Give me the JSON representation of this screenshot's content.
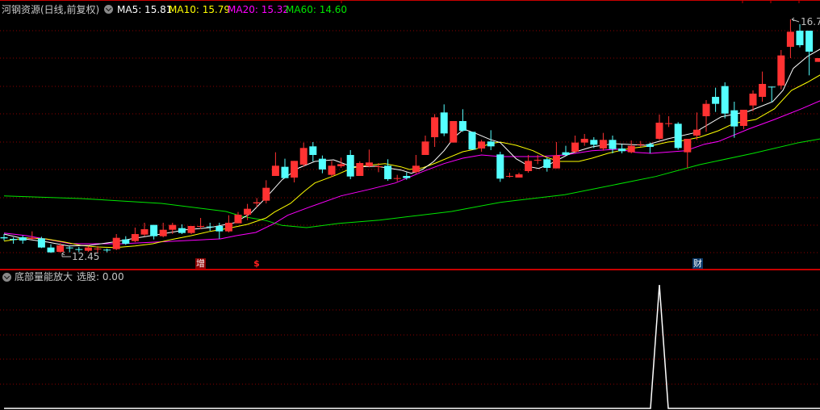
{
  "header": {
    "title": "河钢资源(日线,前复权)",
    "ma5": "MA5: 15.81",
    "ma10": "MA10: 15.79",
    "ma20": "MA20: 15.32",
    "ma60": "MA60: 14.60"
  },
  "lower_header": {
    "indicator_name": "底部量能放大",
    "value_text": "选股: 0.00"
  },
  "labels": {
    "high": "16.7",
    "low": "12.45"
  },
  "markers": {
    "zeng": "增",
    "dollar": "$",
    "cai": "财"
  },
  "colors": {
    "up": "#ff3232",
    "down": "#54ffff",
    "ma5": "#ffffff",
    "ma10": "#ffff00",
    "ma20": "#ff00ff",
    "ma60": "#00e600",
    "grid": "#8b0000",
    "separator": "#c80000"
  },
  "chart_data": {
    "type": "candlestick",
    "price_range": [
      12.45,
      16.78
    ],
    "candles": [
      [
        12.74,
        12.8,
        12.68,
        12.72
      ],
      [
        12.71,
        12.74,
        12.62,
        12.69
      ],
      [
        12.74,
        12.77,
        12.62,
        12.68
      ],
      [
        12.71,
        12.85,
        12.7,
        12.73
      ],
      [
        12.72,
        12.75,
        12.54,
        12.55
      ],
      [
        12.55,
        12.61,
        12.45,
        12.46
      ],
      [
        12.47,
        12.63,
        12.45,
        12.59
      ],
      [
        12.55,
        12.57,
        12.46,
        12.54
      ],
      [
        12.52,
        12.56,
        12.46,
        12.51
      ],
      [
        12.49,
        12.58,
        12.47,
        12.55
      ],
      [
        12.52,
        12.58,
        12.46,
        12.53
      ],
      [
        12.51,
        12.53,
        12.46,
        12.5
      ],
      [
        12.52,
        12.8,
        12.5,
        12.73
      ],
      [
        12.7,
        12.76,
        12.6,
        12.62
      ],
      [
        12.67,
        12.92,
        12.65,
        12.8
      ],
      [
        12.79,
        13.01,
        12.76,
        12.89
      ],
      [
        12.97,
        12.97,
        12.7,
        12.76
      ],
      [
        12.76,
        13.01,
        12.74,
        12.88
      ],
      [
        12.88,
        13.01,
        12.8,
        12.97
      ],
      [
        12.91,
        12.98,
        12.8,
        12.82
      ],
      [
        12.82,
        12.95,
        12.8,
        12.95
      ],
      [
        12.94,
        13.1,
        12.89,
        12.95
      ],
      [
        12.94,
        13.01,
        12.86,
        12.93
      ],
      [
        12.95,
        13.01,
        12.71,
        12.85
      ],
      [
        12.85,
        13.15,
        12.83,
        13.01
      ],
      [
        13.0,
        13.21,
        13.0,
        13.16
      ],
      [
        13.16,
        13.36,
        13.06,
        13.27
      ],
      [
        13.37,
        13.47,
        13.3,
        13.39
      ],
      [
        13.42,
        13.8,
        13.37,
        13.66
      ],
      [
        13.88,
        14.32,
        13.88,
        14.07
      ],
      [
        14.05,
        14.2,
        13.84,
        13.84
      ],
      [
        13.85,
        14.16,
        13.76,
        14.16
      ],
      [
        14.09,
        14.5,
        14.05,
        14.4
      ],
      [
        14.43,
        14.51,
        14.15,
        14.27
      ],
      [
        14.2,
        14.26,
        13.93,
        14.0
      ],
      [
        13.9,
        14.16,
        13.86,
        14.07
      ],
      [
        14.06,
        14.22,
        14.03,
        14.1
      ],
      [
        14.27,
        14.36,
        13.82,
        13.87
      ],
      [
        13.88,
        14.15,
        13.88,
        14.12
      ],
      [
        14.06,
        14.37,
        14.04,
        14.13
      ],
      [
        14.05,
        14.12,
        13.95,
        14.06
      ],
      [
        14.07,
        14.19,
        13.79,
        13.82
      ],
      [
        13.83,
        13.9,
        13.78,
        13.84
      ],
      [
        13.88,
        13.95,
        13.81,
        13.84
      ],
      [
        13.95,
        14.27,
        13.92,
        14.07
      ],
      [
        14.27,
        14.63,
        14.27,
        14.52
      ],
      [
        14.6,
        15.03,
        14.42,
        14.97
      ],
      [
        15.06,
        15.21,
        14.62,
        14.67
      ],
      [
        14.5,
        14.9,
        14.5,
        14.9
      ],
      [
        14.9,
        15.12,
        14.7,
        14.72
      ],
      [
        14.7,
        14.7,
        14.37,
        14.37
      ],
      [
        14.39,
        14.55,
        14.33,
        14.52
      ],
      [
        14.52,
        14.73,
        14.36,
        14.43
      ],
      [
        14.28,
        14.33,
        13.77,
        13.83
      ],
      [
        13.87,
        13.94,
        13.85,
        13.88
      ],
      [
        13.85,
        13.94,
        13.85,
        13.91
      ],
      [
        13.97,
        14.27,
        13.94,
        14.16
      ],
      [
        14.17,
        14.27,
        14.1,
        14.18
      ],
      [
        14.19,
        14.22,
        13.96,
        14.03
      ],
      [
        14.02,
        14.51,
        14.02,
        14.26
      ],
      [
        14.32,
        14.44,
        14.26,
        14.27
      ],
      [
        14.33,
        14.63,
        14.3,
        14.5
      ],
      [
        14.5,
        14.66,
        14.44,
        14.57
      ],
      [
        14.55,
        14.6,
        14.4,
        14.46
      ],
      [
        14.39,
        14.68,
        14.35,
        14.55
      ],
      [
        14.55,
        14.63,
        14.3,
        14.38
      ],
      [
        14.39,
        14.47,
        14.3,
        14.34
      ],
      [
        14.32,
        14.54,
        14.3,
        14.44
      ],
      [
        14.46,
        14.53,
        14.42,
        14.47
      ],
      [
        14.47,
        14.5,
        14.3,
        14.42
      ],
      [
        14.57,
        15.02,
        14.55,
        14.87
      ],
      [
        14.85,
        14.99,
        14.79,
        14.86
      ],
      [
        14.85,
        14.88,
        14.37,
        14.4
      ],
      [
        14.32,
        14.57,
        14.03,
        14.57
      ],
      [
        14.63,
        15.06,
        14.55,
        14.74
      ],
      [
        14.99,
        15.29,
        14.7,
        15.22
      ],
      [
        15.35,
        15.52,
        15.07,
        15.22
      ],
      [
        15.55,
        15.62,
        14.95,
        15.04
      ],
      [
        15.1,
        15.26,
        14.59,
        14.8
      ],
      [
        14.81,
        15.11,
        14.75,
        15.11
      ],
      [
        15.19,
        15.47,
        15.08,
        15.41
      ],
      [
        15.35,
        15.82,
        15.26,
        15.59
      ],
      [
        15.54,
        15.54,
        15.25,
        15.53
      ],
      [
        15.56,
        16.22,
        15.49,
        16.12
      ],
      [
        16.28,
        16.79,
        16.07,
        16.56
      ],
      [
        16.58,
        16.7,
        16.27,
        16.31
      ],
      [
        16.58,
        16.58,
        15.75,
        16.19
      ],
      [
        16.0,
        16.07,
        16.0,
        16.07
      ]
    ],
    "ma5": [
      [
        0,
        12.8
      ],
      [
        2.2,
        12.71
      ],
      [
        4.7,
        12.65
      ],
      [
        6.9,
        12.58
      ],
      [
        9.1,
        12.59
      ],
      [
        11.6,
        12.65
      ],
      [
        14.2,
        12.73
      ],
      [
        16.8,
        12.8
      ],
      [
        19.4,
        12.88
      ],
      [
        22.0,
        12.92
      ],
      [
        24.6,
        13.01
      ],
      [
        26.3,
        13.18
      ],
      [
        28.0,
        13.48
      ],
      [
        29.7,
        13.81
      ],
      [
        31.5,
        14.03
      ],
      [
        33.2,
        14.15
      ],
      [
        35.2,
        14.18
      ],
      [
        37.2,
        14.05
      ],
      [
        39.8,
        14.06
      ],
      [
        42.4,
        13.99
      ],
      [
        43.5,
        13.93
      ],
      [
        44.7,
        14.0
      ],
      [
        45.9,
        14.15
      ],
      [
        47.0,
        14.35
      ],
      [
        48.1,
        14.6
      ],
      [
        49.1,
        14.75
      ],
      [
        50.4,
        14.67
      ],
      [
        51.9,
        14.56
      ],
      [
        53.0,
        14.5
      ],
      [
        54.7,
        14.2
      ],
      [
        56.2,
        14.05
      ],
      [
        57.1,
        14.02
      ],
      [
        58.4,
        14.11
      ],
      [
        60.5,
        14.3
      ],
      [
        62.8,
        14.42
      ],
      [
        65.1,
        14.48
      ],
      [
        68.5,
        14.45
      ],
      [
        70.9,
        14.57
      ],
      [
        73.7,
        14.68
      ],
      [
        76.6,
        14.98
      ],
      [
        79.5,
        15.08
      ],
      [
        82.1,
        15.26
      ],
      [
        83.2,
        15.47
      ],
      [
        84.3,
        15.88
      ],
      [
        85.8,
        16.1
      ],
      [
        87.2,
        16.24
      ]
    ],
    "ma10": [
      [
        0,
        12.67
      ],
      [
        2.4,
        12.73
      ],
      [
        4.5,
        12.71
      ],
      [
        6.5,
        12.65
      ],
      [
        8.2,
        12.59
      ],
      [
        9.9,
        12.56
      ],
      [
        11.9,
        12.55
      ],
      [
        14.0,
        12.58
      ],
      [
        15.9,
        12.62
      ],
      [
        17.9,
        12.7
      ],
      [
        20.0,
        12.77
      ],
      [
        22.0,
        12.85
      ],
      [
        24.0,
        12.91
      ],
      [
        26.0,
        12.98
      ],
      [
        28.0,
        13.1
      ],
      [
        28.9,
        13.21
      ],
      [
        30.6,
        13.37
      ],
      [
        32.1,
        13.6
      ],
      [
        33.2,
        13.75
      ],
      [
        35.5,
        13.9
      ],
      [
        37.2,
        14.03
      ],
      [
        39.0,
        14.08
      ],
      [
        40.7,
        14.11
      ],
      [
        42.4,
        14.05
      ],
      [
        43.3,
        14.0
      ],
      [
        44.7,
        14.03
      ],
      [
        46.1,
        14.12
      ],
      [
        47.6,
        14.23
      ],
      [
        49.0,
        14.33
      ],
      [
        50.4,
        14.38
      ],
      [
        51.9,
        14.48
      ],
      [
        53.0,
        14.51
      ],
      [
        54.7,
        14.45
      ],
      [
        56.5,
        14.35
      ],
      [
        57.9,
        14.23
      ],
      [
        59.3,
        14.15
      ],
      [
        61.4,
        14.15
      ],
      [
        62.8,
        14.21
      ],
      [
        64.5,
        14.3
      ],
      [
        66.8,
        14.39
      ],
      [
        69.1,
        14.44
      ],
      [
        70.9,
        14.51
      ],
      [
        72.6,
        14.54
      ],
      [
        74.3,
        14.6
      ],
      [
        76.3,
        14.72
      ],
      [
        78.0,
        14.86
      ],
      [
        80.3,
        14.93
      ],
      [
        82.3,
        15.13
      ],
      [
        84.1,
        15.47
      ],
      [
        85.8,
        15.62
      ],
      [
        87.2,
        15.76
      ]
    ],
    "ma20": [
      [
        0,
        12.82
      ],
      [
        2.4,
        12.77
      ],
      [
        5.3,
        12.68
      ],
      [
        7.1,
        12.62
      ],
      [
        12.5,
        12.62
      ],
      [
        18.3,
        12.67
      ],
      [
        23.1,
        12.71
      ],
      [
        24.8,
        12.77
      ],
      [
        26.9,
        12.83
      ],
      [
        28.9,
        13.0
      ],
      [
        30.3,
        13.15
      ],
      [
        32.6,
        13.3
      ],
      [
        36.0,
        13.51
      ],
      [
        39.0,
        13.63
      ],
      [
        41.8,
        13.75
      ],
      [
        44.7,
        13.96
      ],
      [
        47.0,
        14.11
      ],
      [
        49.0,
        14.21
      ],
      [
        51.0,
        14.27
      ],
      [
        53.0,
        14.24
      ],
      [
        57.1,
        14.24
      ],
      [
        59.9,
        14.27
      ],
      [
        62.8,
        14.35
      ],
      [
        65.7,
        14.38
      ],
      [
        67.4,
        14.32
      ],
      [
        69.1,
        14.3
      ],
      [
        72.8,
        14.35
      ],
      [
        74.8,
        14.47
      ],
      [
        76.3,
        14.52
      ],
      [
        79.5,
        14.75
      ],
      [
        82.3,
        14.93
      ],
      [
        85.2,
        15.13
      ],
      [
        87.2,
        15.28
      ]
    ],
    "ma60": [
      [
        0,
        13.51
      ],
      [
        8.2,
        13.46
      ],
      [
        16.8,
        13.37
      ],
      [
        23.7,
        13.22
      ],
      [
        25.4,
        13.13
      ],
      [
        28.0,
        13.05
      ],
      [
        29.7,
        12.96
      ],
      [
        32.3,
        12.92
      ],
      [
        35.8,
        13.0
      ],
      [
        40.1,
        13.06
      ],
      [
        44.4,
        13.15
      ],
      [
        47.8,
        13.22
      ],
      [
        53.0,
        13.39
      ],
      [
        59.9,
        13.53
      ],
      [
        69.6,
        13.87
      ],
      [
        74.3,
        14.09
      ],
      [
        80.0,
        14.3
      ],
      [
        84.9,
        14.5
      ],
      [
        87.2,
        14.57
      ]
    ],
    "high_index": 84,
    "low_index": 6,
    "indicator": {
      "name": "底部量能放大",
      "signal_indices": [
        70
      ],
      "range": [
        0,
        1
      ]
    },
    "event_marker_indices": {
      "zeng": 21,
      "dollar": 27,
      "cai": 73
    }
  }
}
